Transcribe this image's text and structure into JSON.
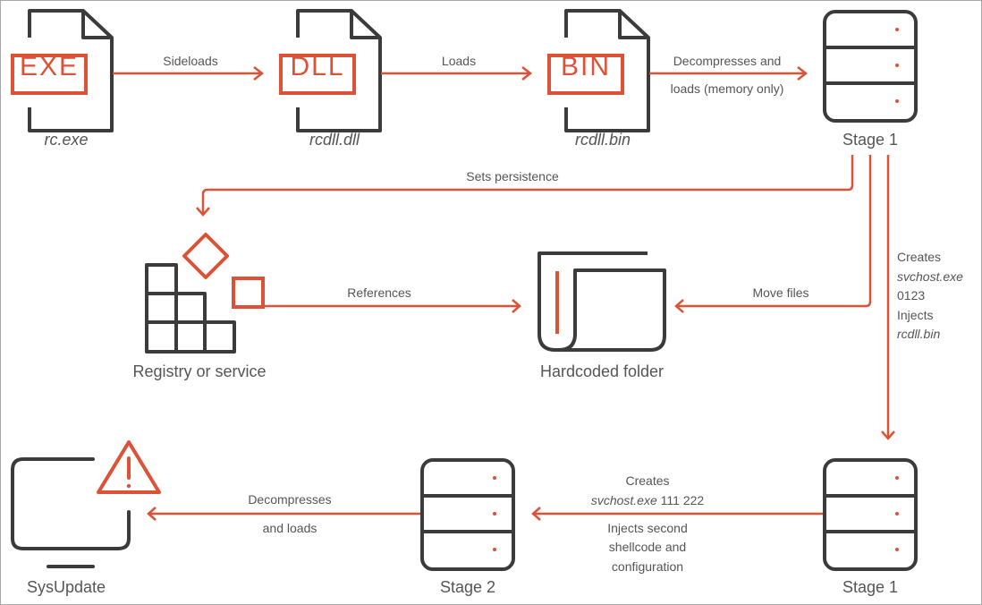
{
  "colors": {
    "accent": "#dd5237",
    "stroke": "#3b3b3b",
    "text": "#555555",
    "border": "#a8a8a8"
  },
  "nodes": {
    "exe": {
      "badge": "EXE",
      "caption": "rc.exe",
      "icon": "file-icon"
    },
    "dll": {
      "badge": "DLL",
      "caption": "rcdll.dll",
      "icon": "file-icon"
    },
    "bin": {
      "badge": "BIN",
      "caption": "rcdll.bin",
      "icon": "file-icon"
    },
    "stage1_top": {
      "caption": "Stage 1",
      "icon": "server-icon"
    },
    "registry": {
      "caption": "Registry or service",
      "icon": "registry-icon"
    },
    "folder": {
      "caption": "Hardcoded folder",
      "icon": "folder-icon"
    },
    "stage1_bottom": {
      "caption": "Stage 1",
      "icon": "server-icon"
    },
    "stage2": {
      "caption": "Stage 2",
      "icon": "server-icon"
    },
    "sysupdate": {
      "caption": "SysUpdate",
      "icon": "monitor-warning-icon"
    }
  },
  "edges": {
    "sideloads": "Sideloads",
    "loads": "Loads",
    "decompresses_line1": "Decompresses and",
    "decompresses_line2": "loads (memory only)",
    "persistence": "Sets persistence",
    "references": "References",
    "move_files": "Move files",
    "creates_block": {
      "line1": "Creates",
      "line2": "svchost.exe",
      "line3": "0123",
      "line4": "Injects",
      "line5": "rcdll.bin"
    },
    "stage2_block": {
      "line1": "Creates",
      "line2_italic": "svchost.exe",
      "line2_rest": " 111 222",
      "line3": "Injects second",
      "line4": "shellcode and",
      "line5": "configuration"
    },
    "final_line1": "Decompresses",
    "final_line2": "and loads"
  }
}
